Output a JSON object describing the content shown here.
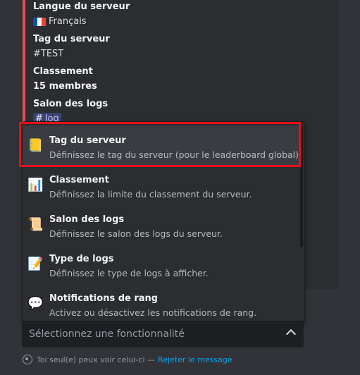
{
  "fields": [
    {
      "name": "Langue du serveur",
      "value": "Français",
      "flag": "france-flag"
    },
    {
      "name": "Tag du serveur",
      "value": "#TEST"
    },
    {
      "name": "Classement",
      "value": "15 membres"
    },
    {
      "name": "Salon des logs",
      "value": "log",
      "channel_hash": "#"
    }
  ],
  "options": [
    {
      "icon": "notebook-icon",
      "glyph": "📒",
      "title": "Tag du serveur",
      "desc": "Définissez le tag du serveur (pour le leaderboard global).",
      "selected": true
    },
    {
      "icon": "bar-chart-icon",
      "glyph": "📊",
      "title": "Classement",
      "desc": "Définissez la limite du classement du serveur."
    },
    {
      "icon": "scroll-icon",
      "glyph": "📜",
      "title": "Salon des logs",
      "desc": "Définissez le salon des logs du serveur."
    },
    {
      "icon": "memo-icon",
      "glyph": "📝",
      "title": "Type de logs",
      "desc": "Définissez le type de logs à afficher."
    },
    {
      "icon": "speech-bubble-icon",
      "glyph": "💬",
      "title": "Notifications de rang",
      "desc": "Activez ou désactivez les notifications de rang."
    }
  ],
  "select": {
    "placeholder": "Sélectionnez une fonctionnalité"
  },
  "footer": {
    "visibility_text": "Toi seul(e) peux voir celui-ci —",
    "dismiss_label": "Rejeter le message"
  },
  "colors": {
    "embed_border": "#e74c5b",
    "highlight": "#e0121b",
    "link": "#00a8fc"
  }
}
